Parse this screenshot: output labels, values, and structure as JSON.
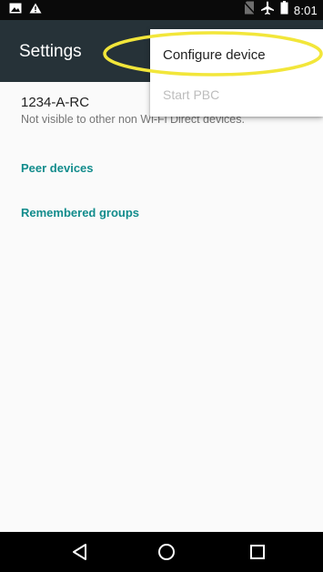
{
  "status_bar": {
    "time": "8:01",
    "icons": [
      "image-icon",
      "warning-icon",
      "no-sim-icon",
      "airplane-icon",
      "battery-icon"
    ]
  },
  "app_bar": {
    "title": "Settings"
  },
  "device": {
    "name": "1234-A-RC",
    "subtitle": "Not visible to other non Wi-Fi Direct devices."
  },
  "sections": {
    "peer_devices": "Peer devices",
    "remembered_groups": "Remembered groups"
  },
  "menu": {
    "items": [
      {
        "label": "Configure device",
        "enabled": true
      },
      {
        "label": "Start PBC",
        "enabled": false
      }
    ]
  },
  "nav_bar": {
    "icons": [
      "back-icon",
      "home-icon",
      "recents-icon"
    ]
  },
  "colors": {
    "status_bar": "#0A0A0A",
    "app_bar": "#263238",
    "accent": "#128C8C",
    "highlight": "#F2E63A",
    "background": "#FAFAFA"
  }
}
